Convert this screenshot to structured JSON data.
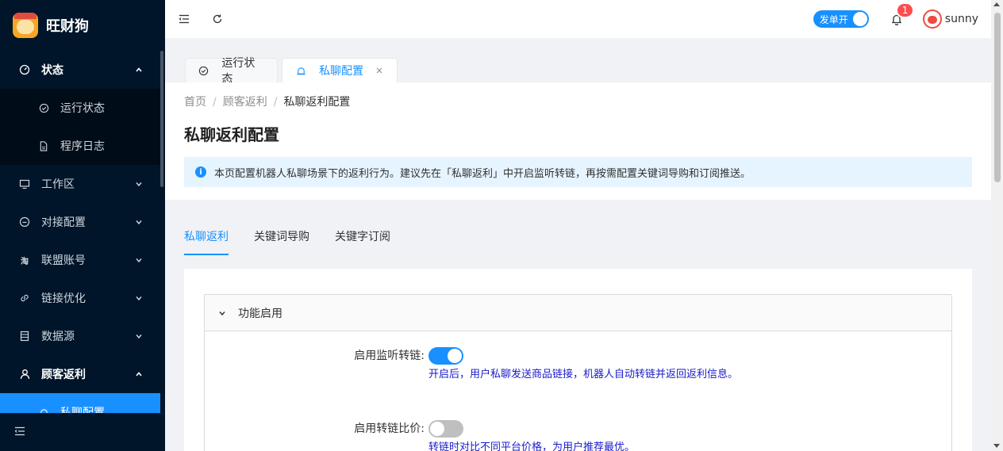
{
  "app": {
    "name": "旺财狗"
  },
  "sidebar": {
    "items": [
      {
        "label": "状态",
        "icon": "dashboard-icon"
      },
      {
        "label": "运行状态",
        "icon": "check-circle-icon"
      },
      {
        "label": "程序日志",
        "icon": "file-icon"
      },
      {
        "label": "工作区",
        "icon": "monitor-icon"
      },
      {
        "label": "对接配置",
        "icon": "smile-icon"
      },
      {
        "label": "联盟账号",
        "icon": "taobao-icon",
        "glyph": "淘"
      },
      {
        "label": "链接优化",
        "icon": "link-icon"
      },
      {
        "label": "数据源",
        "icon": "database-icon"
      },
      {
        "label": "顾客返利",
        "icon": "user-icon"
      },
      {
        "label": "私聊配置",
        "icon": "alert-icon"
      }
    ]
  },
  "header": {
    "order_switch_label": "发单开",
    "notification_count": "1",
    "username": "sunny"
  },
  "tabs": [
    {
      "label": "运行状态",
      "icon": "check-circle-icon"
    },
    {
      "label": "私聊配置",
      "icon": "alert-icon"
    }
  ],
  "breadcrumb": [
    "首页",
    "顾客返利",
    "私聊返利配置"
  ],
  "page": {
    "title": "私聊返利配置",
    "alert": "本页配置机器人私聊场景下的返利行为。建议先在「私聊返利」中开启监听转链，再按需配置关键词导购和订阅推送。"
  },
  "inner_tabs": [
    "私聊返利",
    "关键词导购",
    "关键字订阅"
  ],
  "panel": {
    "title": "功能启用",
    "rows": [
      {
        "label": "启用监听转链:",
        "enabled": true,
        "hint": "开启后，用户私聊发送商品链接，机器人自动转链并返回返利信息。"
      },
      {
        "label": "启用转链比价:",
        "enabled": false,
        "hint": "转链时对比不同平台价格，为用户推荐最优。"
      }
    ]
  },
  "colors": {
    "primary": "#1890ff",
    "sidebar": "#001529",
    "hint": "#1a1acc",
    "badge": "#ff4d4f"
  }
}
